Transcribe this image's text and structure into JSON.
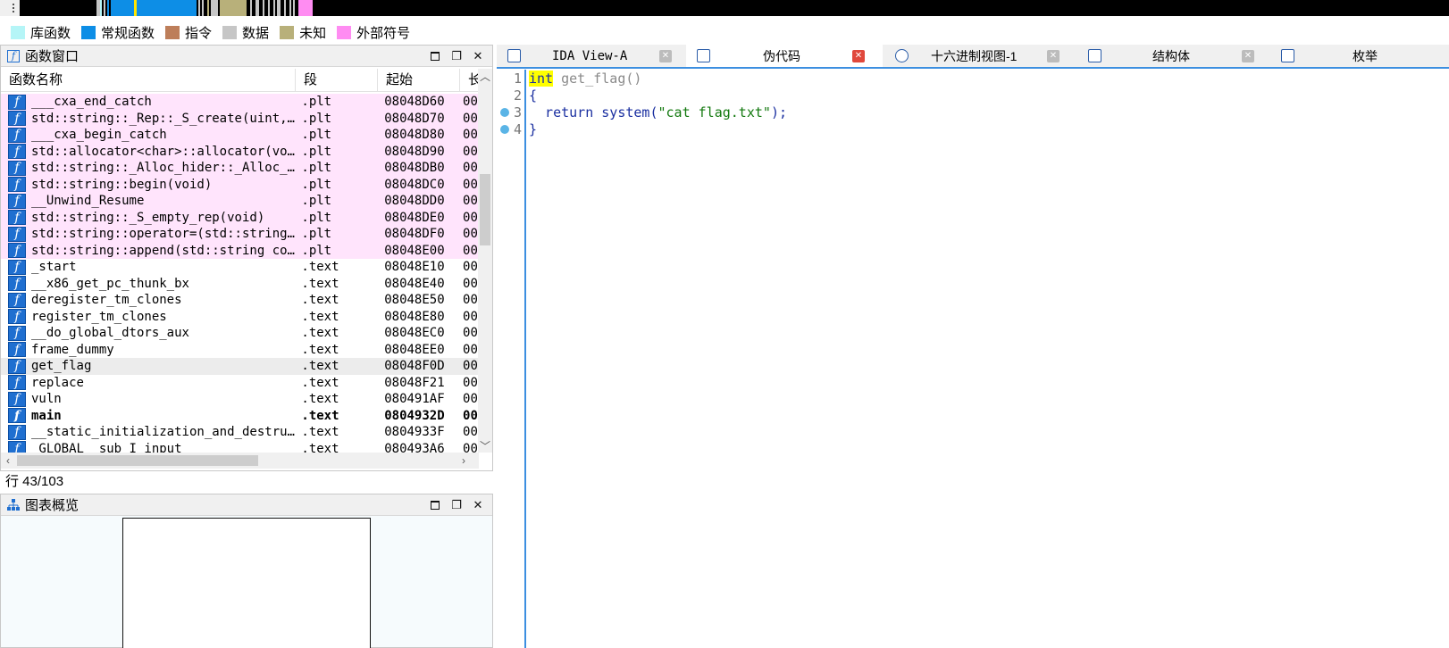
{
  "legend": [
    {
      "label": "库函数",
      "color": "#b5f5f7"
    },
    {
      "label": "常规函数",
      "color": "#0d8ee6"
    },
    {
      "label": "指令",
      "color": "#bd7e5a"
    },
    {
      "label": "数据",
      "color": "#c6c6c6"
    },
    {
      "label": "未知",
      "color": "#b8b07a"
    },
    {
      "label": "外部符号",
      "color": "#ff8cf2"
    }
  ],
  "functions_window": {
    "title": "函数窗口",
    "columns": [
      "函数名称",
      "段",
      "起始",
      "长"
    ],
    "rows": [
      {
        "name": "___cxa_end_catch",
        "segment": ".plt",
        "start": "08048D60",
        "len": "00"
      },
      {
        "name": "std::string::_Rep::_S_create(uint,u…",
        "segment": ".plt",
        "start": "08048D70",
        "len": "00"
      },
      {
        "name": "___cxa_begin_catch",
        "segment": ".plt",
        "start": "08048D80",
        "len": "00"
      },
      {
        "name": "std::allocator<char>::allocator(void)",
        "segment": ".plt",
        "start": "08048D90",
        "len": "00"
      },
      {
        "name": "std::string::_Alloc_hider::_Alloc_h…",
        "segment": ".plt",
        "start": "08048DB0",
        "len": "00"
      },
      {
        "name": "std::string::begin(void)",
        "segment": ".plt",
        "start": "08048DC0",
        "len": "00"
      },
      {
        "name": "__Unwind_Resume",
        "segment": ".plt",
        "start": "08048DD0",
        "len": "00"
      },
      {
        "name": "std::string::_S_empty_rep(void)",
        "segment": ".plt",
        "start": "08048DE0",
        "len": "00"
      },
      {
        "name": "std::string::operator=(std::string …",
        "segment": ".plt",
        "start": "08048DF0",
        "len": "00"
      },
      {
        "name": "std::string::append(std::string con…",
        "segment": ".plt",
        "start": "08048E00",
        "len": "00"
      },
      {
        "name": "_start",
        "segment": ".text",
        "start": "08048E10",
        "len": "00"
      },
      {
        "name": "__x86_get_pc_thunk_bx",
        "segment": ".text",
        "start": "08048E40",
        "len": "00"
      },
      {
        "name": "deregister_tm_clones",
        "segment": ".text",
        "start": "08048E50",
        "len": "00"
      },
      {
        "name": "register_tm_clones",
        "segment": ".text",
        "start": "08048E80",
        "len": "00"
      },
      {
        "name": "__do_global_dtors_aux",
        "segment": ".text",
        "start": "08048EC0",
        "len": "00"
      },
      {
        "name": "frame_dummy",
        "segment": ".text",
        "start": "08048EE0",
        "len": "00"
      },
      {
        "name": "get_flag",
        "segment": ".text",
        "start": "08048F0D",
        "len": "00"
      },
      {
        "name": "replace",
        "segment": ".text",
        "start": "08048F21",
        "len": "00"
      },
      {
        "name": "vuln",
        "segment": ".text",
        "start": "080491AF",
        "len": "00"
      },
      {
        "name": "main",
        "segment": ".text",
        "start": "0804932D",
        "len": "00"
      },
      {
        "name": "__static_initialization_and_destruc…",
        "segment": ".text",
        "start": "0804933F",
        "len": "00"
      },
      {
        "name": "_GLOBAL__sub_I_input",
        "segment": ".text",
        "start": "080493A6",
        "len": "00"
      }
    ],
    "status": "行 43/103"
  },
  "graph_overview": {
    "title": "图表概览"
  },
  "tabs": [
    {
      "label": "IDA View-A",
      "icon": "ida-view-icon"
    },
    {
      "label": "伪代码",
      "icon": "pseudocode-icon"
    },
    {
      "label": "十六进制视图-1",
      "icon": "hex-view-icon"
    },
    {
      "label": "结构体",
      "icon": "structures-icon"
    },
    {
      "label": "枚举",
      "icon": "enums-icon"
    }
  ],
  "pseudocode": {
    "line_numbers": [
      "1",
      "2",
      "3",
      "4"
    ],
    "line1": {
      "kw": "int",
      "rest": " get_flag()"
    },
    "line2": "{",
    "line3": {
      "ret": "  return ",
      "fn": "system",
      "open": "(",
      "str": "\"cat flag.txt\"",
      "close": ");"
    },
    "line4": "}"
  }
}
